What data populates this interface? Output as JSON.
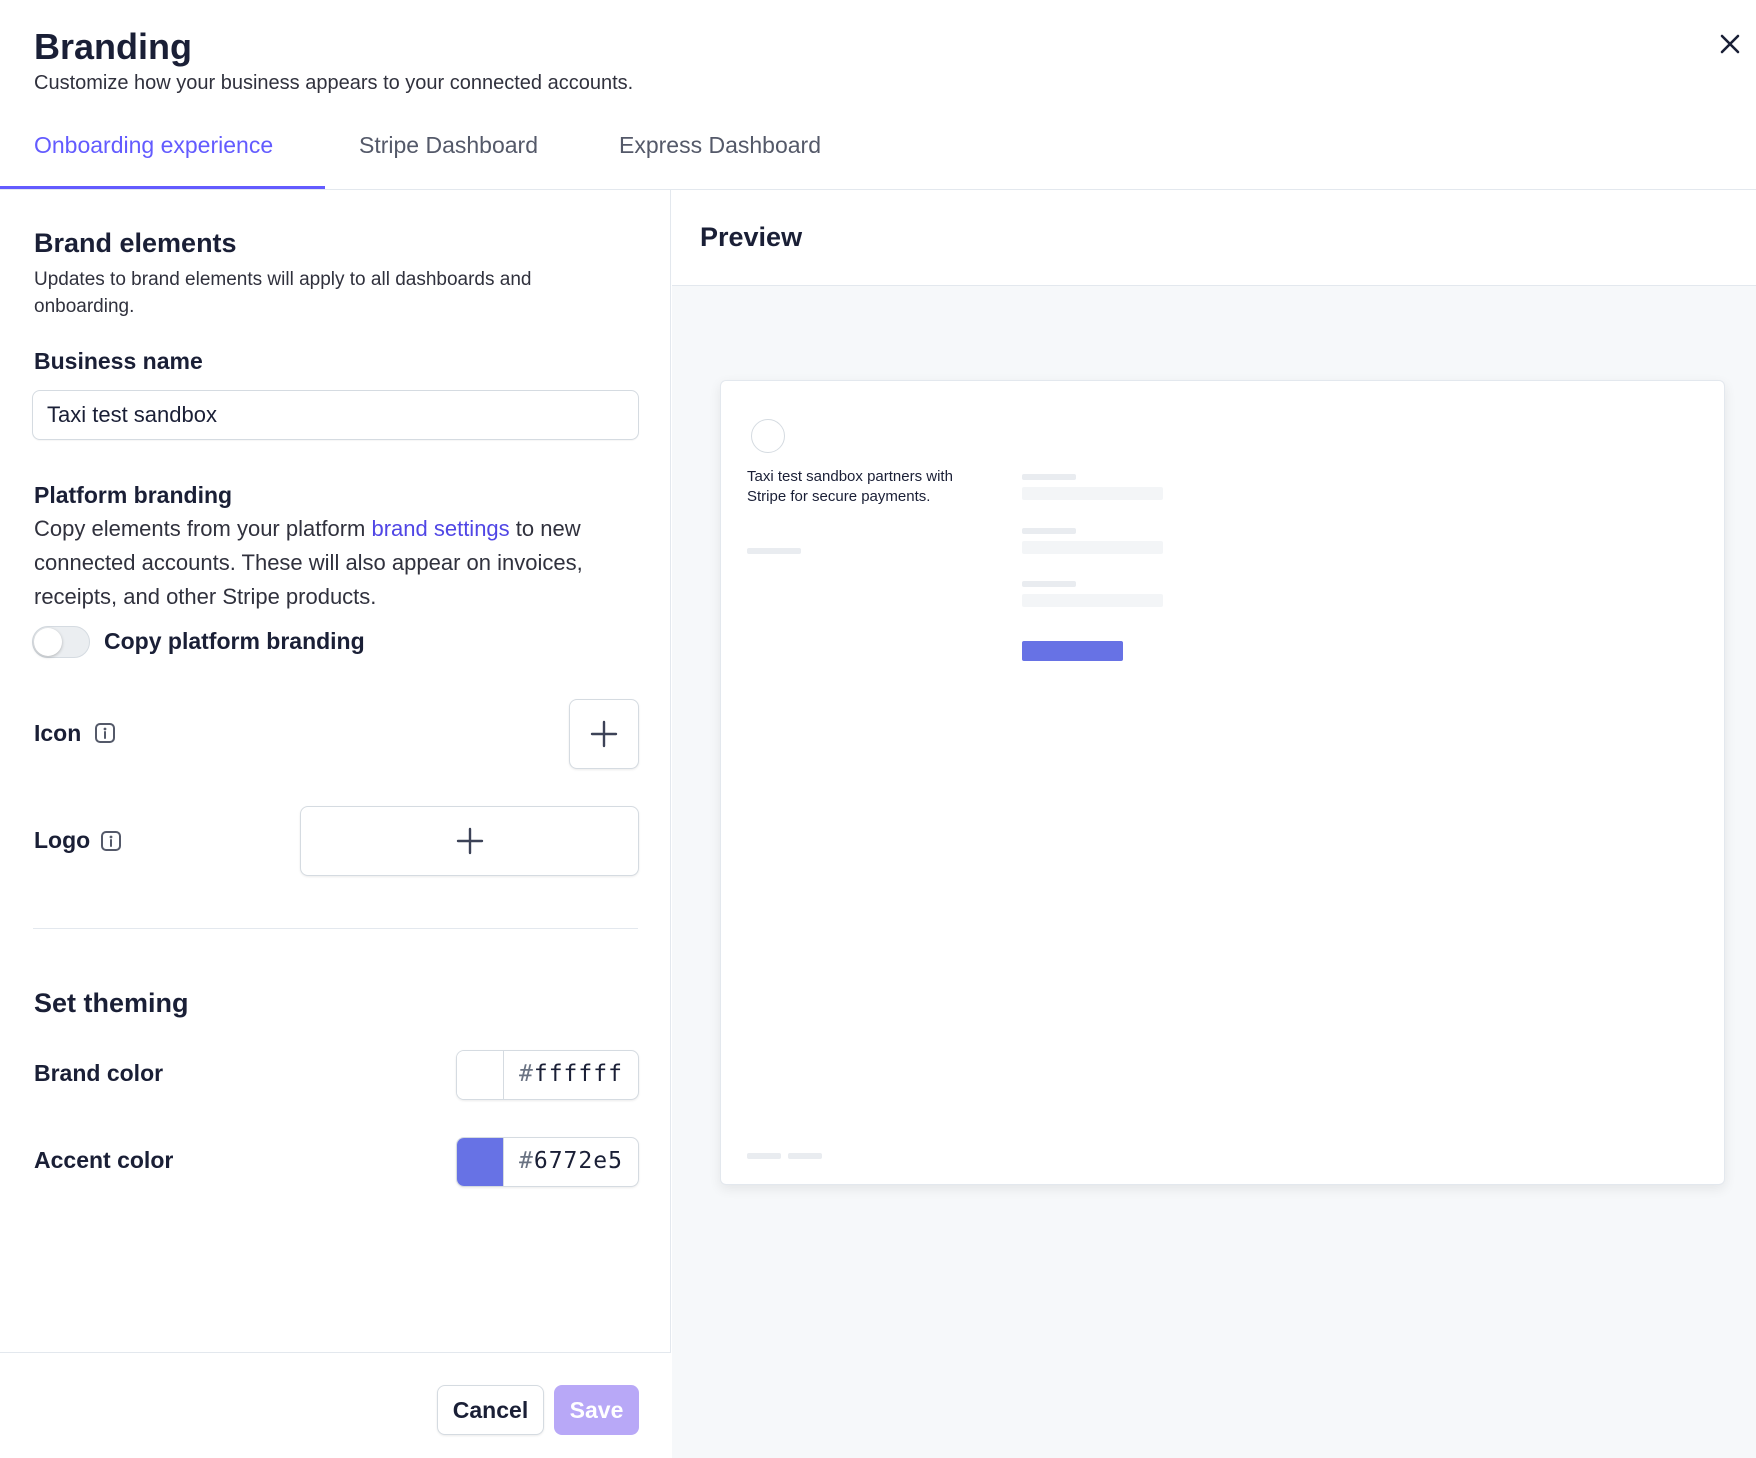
{
  "header": {
    "title": "Branding",
    "subtitle": "Customize how your business appears to your connected accounts.",
    "tabs": [
      {
        "label": "Onboarding experience",
        "active": true
      },
      {
        "label": "Stripe Dashboard",
        "active": false
      },
      {
        "label": "Express Dashboard",
        "active": false
      }
    ],
    "close_icon": "close-icon"
  },
  "brand_elements": {
    "title": "Brand elements",
    "description": "Updates to brand elements will apply to all dashboards and onboarding."
  },
  "business_name": {
    "label": "Business name",
    "value": "Taxi test sandbox"
  },
  "platform_branding": {
    "label": "Platform branding",
    "text_before": "Copy elements from your platform ",
    "link": "brand settings",
    "text_after": " to new connected accounts. These will also appear on invoices, receipts, and other Stripe products.",
    "toggle_label": "Copy platform branding",
    "toggle_on": false
  },
  "icon_field": {
    "label": "Icon",
    "info_icon": "info-icon",
    "upload_icon": "plus-icon"
  },
  "logo_field": {
    "label": "Logo",
    "info_icon": "info-icon",
    "upload_icon": "plus-icon"
  },
  "theming": {
    "title": "Set theming",
    "brand_color": {
      "label": "Brand color",
      "hash": "#",
      "value": "ffffff",
      "swatch": "#ffffff"
    },
    "accent_color": {
      "label": "Accent color",
      "hash": "#",
      "value": "6772e5",
      "swatch": "#6772e5"
    }
  },
  "footer": {
    "cancel_label": "Cancel",
    "save_label": "Save"
  },
  "preview": {
    "title": "Preview",
    "card_text": "Taxi test sandbox partners with Stripe for secure payments.",
    "button_color": "#6772e5"
  },
  "colors": {
    "accent": "#635bff",
    "link": "#5046e5",
    "save_disabled": "#b8a8f7"
  }
}
